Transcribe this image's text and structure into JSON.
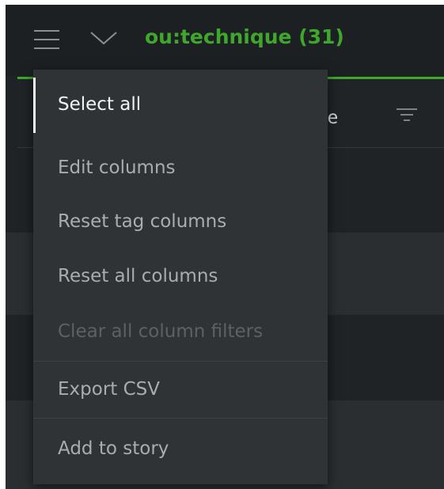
{
  "header": {
    "title": "ou:technique (31)",
    "menu_icon": "hamburger-menu-icon",
    "expand_icon": "chevron-down-icon",
    "accent_color": "#3fa72b"
  },
  "table": {
    "visible_column_header": "ique",
    "filter_icon": "filter-icon"
  },
  "menu": {
    "items": [
      {
        "label": "Select all",
        "state": "selected"
      },
      {
        "label": "Edit columns",
        "state": "enabled"
      },
      {
        "label": "Reset tag columns",
        "state": "enabled"
      },
      {
        "label": "Reset all columns",
        "state": "enabled"
      },
      {
        "label": "Clear all column filters",
        "state": "disabled"
      },
      {
        "label": "Export CSV",
        "state": "enabled"
      },
      {
        "label": "Add to story",
        "state": "enabled"
      }
    ]
  }
}
